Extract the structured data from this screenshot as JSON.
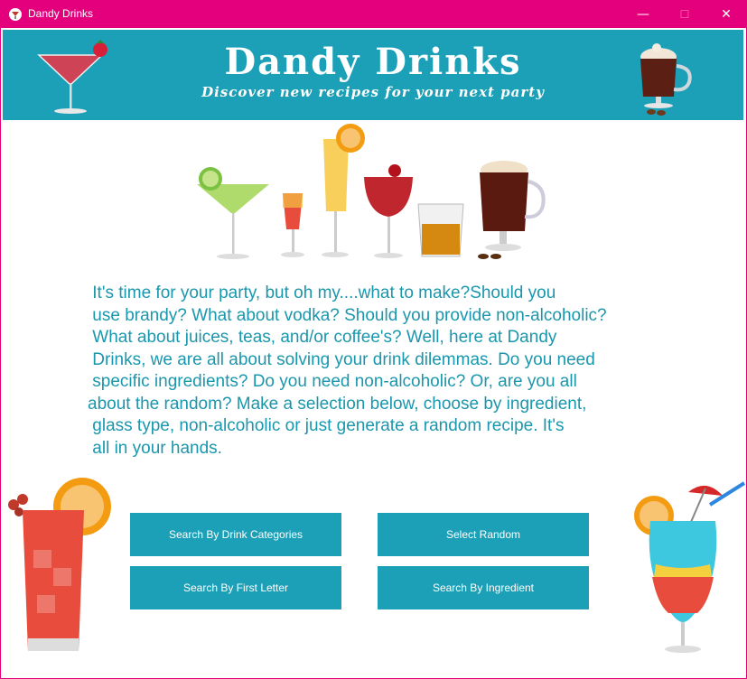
{
  "window": {
    "title": "Dandy Drinks",
    "controls": {
      "minimize": "—",
      "maximize": "☐",
      "close": "✕"
    }
  },
  "banner": {
    "title": "Dandy Drinks",
    "subtitle": "Discover new recipes for your next party"
  },
  "intro": {
    "lines": [
      " It's time for your party, but oh my....what to make?Should you",
      " use brandy? What about vodka? Should you provide non-alcoholic?",
      " What about juices, teas, and/or coffee's? Well, here at Dandy",
      " Drinks, we are all about solving your drink dilemmas. Do you need",
      " specific ingredients? Do you need non-alcoholic? Or, are you all",
      "about the random? Make a selection below, choose by ingredient,",
      " glass type, non-alcoholic or just generate a random recipe. It's",
      " all in your hands."
    ]
  },
  "buttons": {
    "categories": "Search By Drink Categories",
    "random": "Select Random",
    "first_letter": "Search By First Letter",
    "ingredient": "Search By Ingredient"
  },
  "colors": {
    "titlebar": "#e4007c",
    "accent": "#1ba0b7",
    "text": "#1a97ad"
  },
  "icons": [
    "app-icon",
    "cocktail-glass-icon",
    "coffee-mug-icon",
    "drinks-illustration",
    "red-juice-glass-icon",
    "blue-cocktail-icon"
  ]
}
